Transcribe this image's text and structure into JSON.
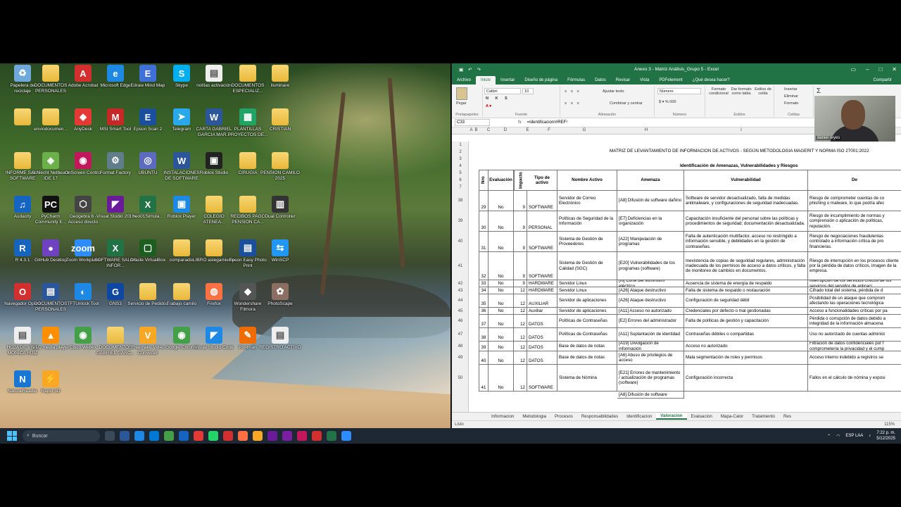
{
  "desktop": {
    "icons": [
      {
        "label": "Papelera de reciclaje",
        "color": "#6fa8dc",
        "glyph": "♻"
      },
      {
        "label": "DOCUMENTOS PERSONALES",
        "color": "folder",
        "glyph": ""
      },
      {
        "label": "Adobe Acrobat",
        "color": "#d32f2f",
        "glyph": "A"
      },
      {
        "label": "Microsoft Edge",
        "color": "#1e88e5",
        "glyph": "e"
      },
      {
        "label": "Edraw Mind Map",
        "color": "#3f6fd8",
        "glyph": "E"
      },
      {
        "label": "Skype",
        "color": "#00aff0",
        "glyph": "S"
      },
      {
        "label": "notitas activación",
        "color": "#eeeeee",
        "glyph": "▤"
      },
      {
        "label": "DOCUMENTOS ESPECIALIZ...",
        "color": "folder",
        "glyph": ""
      },
      {
        "label": "iluminare",
        "color": "folder",
        "glyph": ""
      },
      {
        "label": "",
        "color": "folder",
        "glyph": ""
      },
      {
        "label": "enviodocumen...",
        "color": "folder",
        "glyph": ""
      },
      {
        "label": "AnyDesk",
        "color": "#e53935",
        "glyph": "◆"
      },
      {
        "label": "MSI Smart Tool",
        "color": "#c62828",
        "glyph": "M"
      },
      {
        "label": "Epson Scan 2",
        "color": "#1a4fa0",
        "glyph": "E"
      },
      {
        "label": "Telegram",
        "color": "#29a9eb",
        "glyph": "➤"
      },
      {
        "label": "CARTA GABRIEL GARCIA MAR...",
        "color": "#2b579a",
        "glyph": "W"
      },
      {
        "label": "PLANTILLAS PROYECTOS DE...",
        "color": "#21a366",
        "glyph": "▦"
      },
      {
        "label": "CRISTIAN",
        "color": "folder",
        "glyph": ""
      },
      {
        "label": "INFORME SALA SOFTWARE",
        "color": "folder",
        "glyph": ""
      },
      {
        "label": "Schlecht Netbeans IDE 17",
        "color": "#6cb04c",
        "glyph": "◈"
      },
      {
        "label": "OnScreen Control",
        "color": "#c2185b",
        "glyph": "◉"
      },
      {
        "label": "Format Factory",
        "color": "#607d8b",
        "glyph": "⚙"
      },
      {
        "label": "UBUNTU",
        "color": "#5c6bc0",
        "glyph": "◎"
      },
      {
        "label": "INSTALACIONES DE SOFTWARE",
        "color": "#2b579a",
        "glyph": "W"
      },
      {
        "label": "Roblox Studio",
        "color": "#222",
        "glyph": "▣"
      },
      {
        "label": "CIRUGIA",
        "color": "folder",
        "glyph": ""
      },
      {
        "label": "PENSION CAMILO 2025",
        "color": "folder",
        "glyph": ""
      },
      {
        "label": "Audacity",
        "color": "#1565c0",
        "glyph": "♫"
      },
      {
        "label": "PyCharm Community E...",
        "color": "#111",
        "glyph": "PC"
      },
      {
        "label": "Geogebra 6 - Acceso directo",
        "color": "#444",
        "glyph": "⬡"
      },
      {
        "label": "Visual Studio 2019",
        "color": "#6a1b9a",
        "glyph": "◤"
      },
      {
        "label": "neo01Simula...",
        "color": "#217346",
        "glyph": "X"
      },
      {
        "label": "Roblox Player",
        "color": "#1e88e5",
        "glyph": "▣"
      },
      {
        "label": "COLEGIO ATENEA...",
        "color": "folder",
        "glyph": ""
      },
      {
        "label": "RECIBOS PAGO PENSION CA...",
        "color": "folder",
        "glyph": ""
      },
      {
        "label": "Dual Controller",
        "color": "#333",
        "glyph": "▥"
      },
      {
        "label": "R 4.3.1",
        "color": "#1565c0",
        "glyph": "R"
      },
      {
        "label": "GitHub Desktop",
        "color": "#6f42c1",
        "glyph": "●"
      },
      {
        "label": "Zoom Workplace",
        "color": "#2d8cff",
        "glyph": "zoom"
      },
      {
        "label": "SOFTWARE SALAS INFOR...",
        "color": "#217346",
        "glyph": "X"
      },
      {
        "label": "Oracle VirtualBox",
        "color": "#1b5e20",
        "glyph": "▢"
      },
      {
        "label": "comparador",
        "color": "folder",
        "glyph": ""
      },
      {
        "label": "LIBRO aslegamiento",
        "color": "folder",
        "glyph": ""
      },
      {
        "label": "Epson Easy Photo Print",
        "color": "#1a4fa0",
        "glyph": "▤"
      },
      {
        "label": "WinSCP",
        "color": "#2196f3",
        "glyph": "⇆"
      },
      {
        "label": "Navegador Opera",
        "color": "#d32f2f",
        "glyph": "O"
      },
      {
        "label": "DOCUMENTOS PERSONALES",
        "color": "#2b579a",
        "glyph": "▤"
      },
      {
        "label": "TFTUnlock Tool",
        "color": "#1e88e5",
        "glyph": "◐"
      },
      {
        "label": "GNS3",
        "color": "#0d47a1",
        "glyph": "G"
      },
      {
        "label": "Servicio de Pedidos",
        "color": "folder",
        "glyph": ""
      },
      {
        "label": "Trabajo camilo",
        "color": "folder",
        "glyph": ""
      },
      {
        "label": "Firefox",
        "color": "#ff7043",
        "glyph": "◍"
      },
      {
        "label": "Wondershare Filmora",
        "color": "#555",
        "glyph": "◆"
      },
      {
        "label": "PhotoScape",
        "color": "#8d6e63",
        "glyph": "✿"
      },
      {
        "label": "HOJA DE VIDA MONICA RUIZ",
        "color": "#eeeeee",
        "glyph": "▤"
      },
      {
        "label": "VLC media player",
        "color": "#ff8f00",
        "glyph": "▲"
      },
      {
        "label": "Cisco Webex",
        "color": "#43a047",
        "glyph": "◉"
      },
      {
        "label": "DOCUMENTOS GABRIEL GARC...",
        "color": "folder",
        "glyph": ""
      },
      {
        "label": "Freemake Video Converter",
        "color": "#f9a825",
        "glyph": "V"
      },
      {
        "label": "Google Chrome",
        "color": "#43a047",
        "glyph": "◉"
      },
      {
        "label": "Visual Studio Code",
        "color": "#1e88e5",
        "glyph": "◤"
      },
      {
        "label": "Postman",
        "color": "#ef6c00",
        "glyph": "✎"
      },
      {
        "label": "REGISTRO ACTIVO",
        "color": "#eeeeee",
        "glyph": "▤"
      },
      {
        "label": "NaturalReader",
        "color": "#1976d2",
        "glyph": "N"
      },
      {
        "label": "Rapid 3D",
        "color": "#f9a825",
        "glyph": "⚡"
      }
    ]
  },
  "taskbar": {
    "search_placeholder": "Buscar",
    "apps": [
      "#3a4a58",
      "#2b579a",
      "#1e88e5",
      "#0078d4",
      "#43a047",
      "#1565c0",
      "#e53935",
      "#25d366",
      "#d32f2f",
      "#ff7043",
      "#f9a825",
      "#6a1b9a",
      "#7b1fa2",
      "#c2185b",
      "#d32f2f",
      "#217346",
      "#2d8cff"
    ],
    "lang": "ESP LAA",
    "time": "7:22 p. m.",
    "date": "5/12/2025"
  },
  "excel": {
    "title": "Anexo 3 - Matriz Análisis_Grupo 5 - Excel",
    "tabs": [
      "Archivo",
      "Inicio",
      "Insertar",
      "Diseño de página",
      "Fórmulas",
      "Datos",
      "Revisar",
      "Vista",
      "PDFelement"
    ],
    "tell_me": "¿Qué desea hacer?",
    "share": "Compartir",
    "ribbon": {
      "portapapeles": "Portapapeles",
      "pegar": "Pegar",
      "font_name": "Calibri",
      "font_size": "10",
      "fuente": "Fuente",
      "ajustar": "Ajustar texto",
      "combinar": "Combinar y centrar",
      "alineacion": "Alineación",
      "numero_fmt": "Número",
      "numero": "Número",
      "formato_cond": "Formato condicional",
      "dar_formato": "Dar formato como tabla",
      "estilos_celda": "Estilos de celda",
      "estilos": "Estilos",
      "insertar": "Insertar",
      "eliminar": "Eliminar",
      "formato": "Formato",
      "celdas": "Celdas"
    },
    "name_box": "C33",
    "formula": "=Identificacion!#REF!",
    "col_headers": [
      "A",
      "B",
      "C",
      "D",
      "E",
      "F",
      "G",
      "H",
      "I",
      "J"
    ],
    "sheet_title": "MATRIZ DE LEVANTAMIENTO DE INFORMACION DE ACTIVOS - SEGÚN METODOLOGIA MAGERIT Y NORMA ISO 27001:2022",
    "section_title": "Identificación de Amenazas, Vulnerabilidades y Riesgos",
    "headers": {
      "nro": "Nro",
      "evaluacion": "Evaluación",
      "impacto": "Impacto",
      "tipo": "Tipo de activo",
      "nombre": "Nombre Activo",
      "amenaza": "Amenaza",
      "vulnerabilidad": "Vulnerabilidad",
      "desc": "De"
    },
    "rows": [
      {
        "r": "38",
        "nro": "29",
        "ev": "No",
        "imp": "9",
        "tipo": "SOFTWARE",
        "nombre": "Servidor de Correo Electrónico",
        "amenaza": "[A8] Difusión de software dañino",
        "vuln": "Software de servidor desactualizado, falta de medidas antimalware, y configuraciones de seguridad inadecuadas.",
        "desc": "Riesgo de comprometer cuentas de co phishing o malware, lo que podría afec"
      },
      {
        "r": "39",
        "nro": "30",
        "ev": "No",
        "imp": "9",
        "tipo": "PERSONAL",
        "nombre": "Políticas de Seguridad de la Información",
        "amenaza": "[E7] Deficiencias en la organización",
        "vuln": "Capacitación insuficiente del personal sobre las políticas y procedimientos de seguridad; documentación desactualizada.",
        "desc": "Riesgo de incumplimiento de normas y comprensión o aplicación de políticas, reputación."
      },
      {
        "r": "40",
        "nro": "31",
        "ev": "No",
        "imp": "9",
        "tipo": "SOFTWARE",
        "nombre": "Sistema de Gestión de Proveedores",
        "amenaza": "[A22] Manipulación de programas",
        "vuln": "Falta de autenticación multifactor, acceso no restringido a información sensible, y debilidades en la gestión de contraseñas.",
        "desc": "Riesgo de negociaciones fraudulentas controlado a información crítica de pro financieras."
      },
      {
        "r": "41",
        "nro": "32",
        "ev": "No",
        "imp": "9",
        "tipo": "SOFTWARE",
        "nombre": "Sistema de Gestión de Calidad (SGC)",
        "amenaza": "[E20] Vulnerabilidades de los programas (software)",
        "vuln": "Inexistencia de copias de seguridad regulares, administración inadecuada de los permisos de acceso a datos críticos, y falta de monitoreo de cambios en documentos.",
        "desc": "Riesgo de interrupción en los procesos cliente por la pérdida de datos críticos, imagen de la empresa."
      },
      {
        "r": "42",
        "nro": "33",
        "ev": "No",
        "imp": "9",
        "tipo": "HARDWARE",
        "nombre": "Servidor Linux",
        "amenaza": "[I6] Corte del suministro eléctrico",
        "vuln": "Ausencia de sistema de energía de respaldo",
        "desc": "Interrupción de los servicios críticos de los servicios del servidor de aplicaci"
      },
      {
        "r": "43",
        "nro": "34",
        "ev": "No",
        "imp": "12",
        "tipo": "HARDWARE",
        "nombre": "Servidor Linux",
        "amenaza": "[A26] Ataque destructivo",
        "vuln": "Falta de sistema de respaldo o restauración",
        "desc": "Cifrado total del sistema, pérdida de d"
      },
      {
        "r": "44",
        "nro": "35",
        "ev": "No",
        "imp": "12",
        "tipo": "AUXILIAR",
        "nombre": "Servidor de aplicaciones",
        "amenaza": "[A26] Ataque destructivo",
        "vuln": "Configuración de seguridad débil",
        "desc": "Posibilidad de un ataque que comprom afectando las operaciones tecnológica"
      },
      {
        "r": "45",
        "nro": "36",
        "ev": "No",
        "imp": "12",
        "tipo": "Auxiliar",
        "nombre": "Servidor de aplicaciones",
        "amenaza": "[A11] Acceso no autorizado",
        "vuln": "Credenciales por defecto o mal gestionadas",
        "desc": "Acceso a funcionalidades críticas por pa"
      },
      {
        "r": "46",
        "nro": "37",
        "ev": "No",
        "imp": "12",
        "tipo": "DATOS",
        "nombre": "Políticas de Contraseñas",
        "amenaza": "[E2] Errores del administrador",
        "vuln": "Falta de políticas de gestión y capacitación",
        "desc": "Pérdida o corrupción de datos debido a integridad de la información almacena"
      },
      {
        "r": "47",
        "nro": "38",
        "ev": "No",
        "imp": "12",
        "tipo": "DATOS",
        "nombre": "Políticas de Contraseñas",
        "amenaza": "[A11] Suplantación de identidad",
        "vuln": "Contraseñas débiles o compartidas",
        "desc": "Uso no autorizado de cuentas administ"
      },
      {
        "r": "48",
        "nro": "39",
        "ev": "No",
        "imp": "12",
        "tipo": "DATOS",
        "nombre": "Base de datos de notas",
        "amenaza": "[A19] Divulgación de información",
        "vuln": "Acceso no autorizado",
        "desc": "Filtración de datos confidenciales por f comprometería la privacidad y el cump"
      },
      {
        "r": "49",
        "nro": "40",
        "ev": "No",
        "imp": "12",
        "tipo": "DATOS",
        "nombre": "Base de datos de notas",
        "amenaza": "[A6] Abuso de privilegios de acceso",
        "vuln": "Mala segmentación de roles y permisos",
        "desc": "Acceso interno indebido a registros se"
      },
      {
        "r": "50",
        "nro": "41",
        "ev": "No",
        "imp": "12",
        "tipo": "SOFTWARE",
        "nombre": "Sistema de Nómina",
        "amenaza": "[E21] Errores de mantenimiento / actualización de programas (software)",
        "vuln": "Configuración incorrecta",
        "desc": "Fallos en el cálculo de nómina y exposi"
      }
    ],
    "last_partial": "[A8] Difusión de software",
    "sheet_tabs": [
      "Informacion",
      "Metodologia",
      "Procesos",
      "Responsabilidades",
      "Identificacion",
      "Valoracion",
      "Evaluacion",
      "Mapa-Calor",
      "Tratamiento",
      "Res"
    ],
    "active_sheet": "Valoracion",
    "status_text": "Listo",
    "zoom": "115%",
    "webcam_name": "daniel reyes"
  }
}
